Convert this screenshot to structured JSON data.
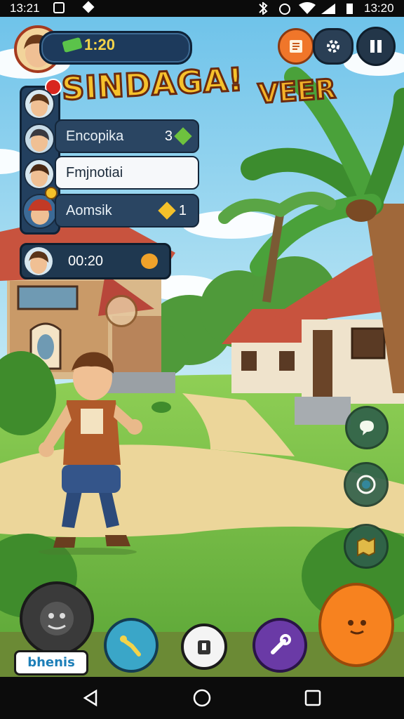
{
  "status_bar": {
    "left_time": "13:21",
    "right_time": "13:20"
  },
  "hud": {
    "timer": "1:20",
    "title_main": "SINDAGA!",
    "title_side": "VEER"
  },
  "players": [
    {
      "name": "Encopika",
      "score": "3"
    },
    {
      "name": "Fmjnotiai",
      "score": ""
    },
    {
      "name": "Aomsik",
      "score": "1"
    }
  ],
  "countdown": "00:20",
  "bottom_label": "bhenis",
  "icons": {
    "book": "book-icon",
    "gear": "gear-icon",
    "pause": "pause-icon",
    "chat": "speech-bubble-icon",
    "target": "target-icon",
    "map": "map-icon",
    "skill": "dino-skill-icon",
    "sword": "sword-icon",
    "backpack": "backpack-icon",
    "tool": "wrench-icon"
  },
  "colors": {
    "sky": "#8fd3ee",
    "grass": "#7cc24d",
    "path": "#ecd69a",
    "title": "#f6c22c",
    "accent_orange": "#f7821f"
  }
}
